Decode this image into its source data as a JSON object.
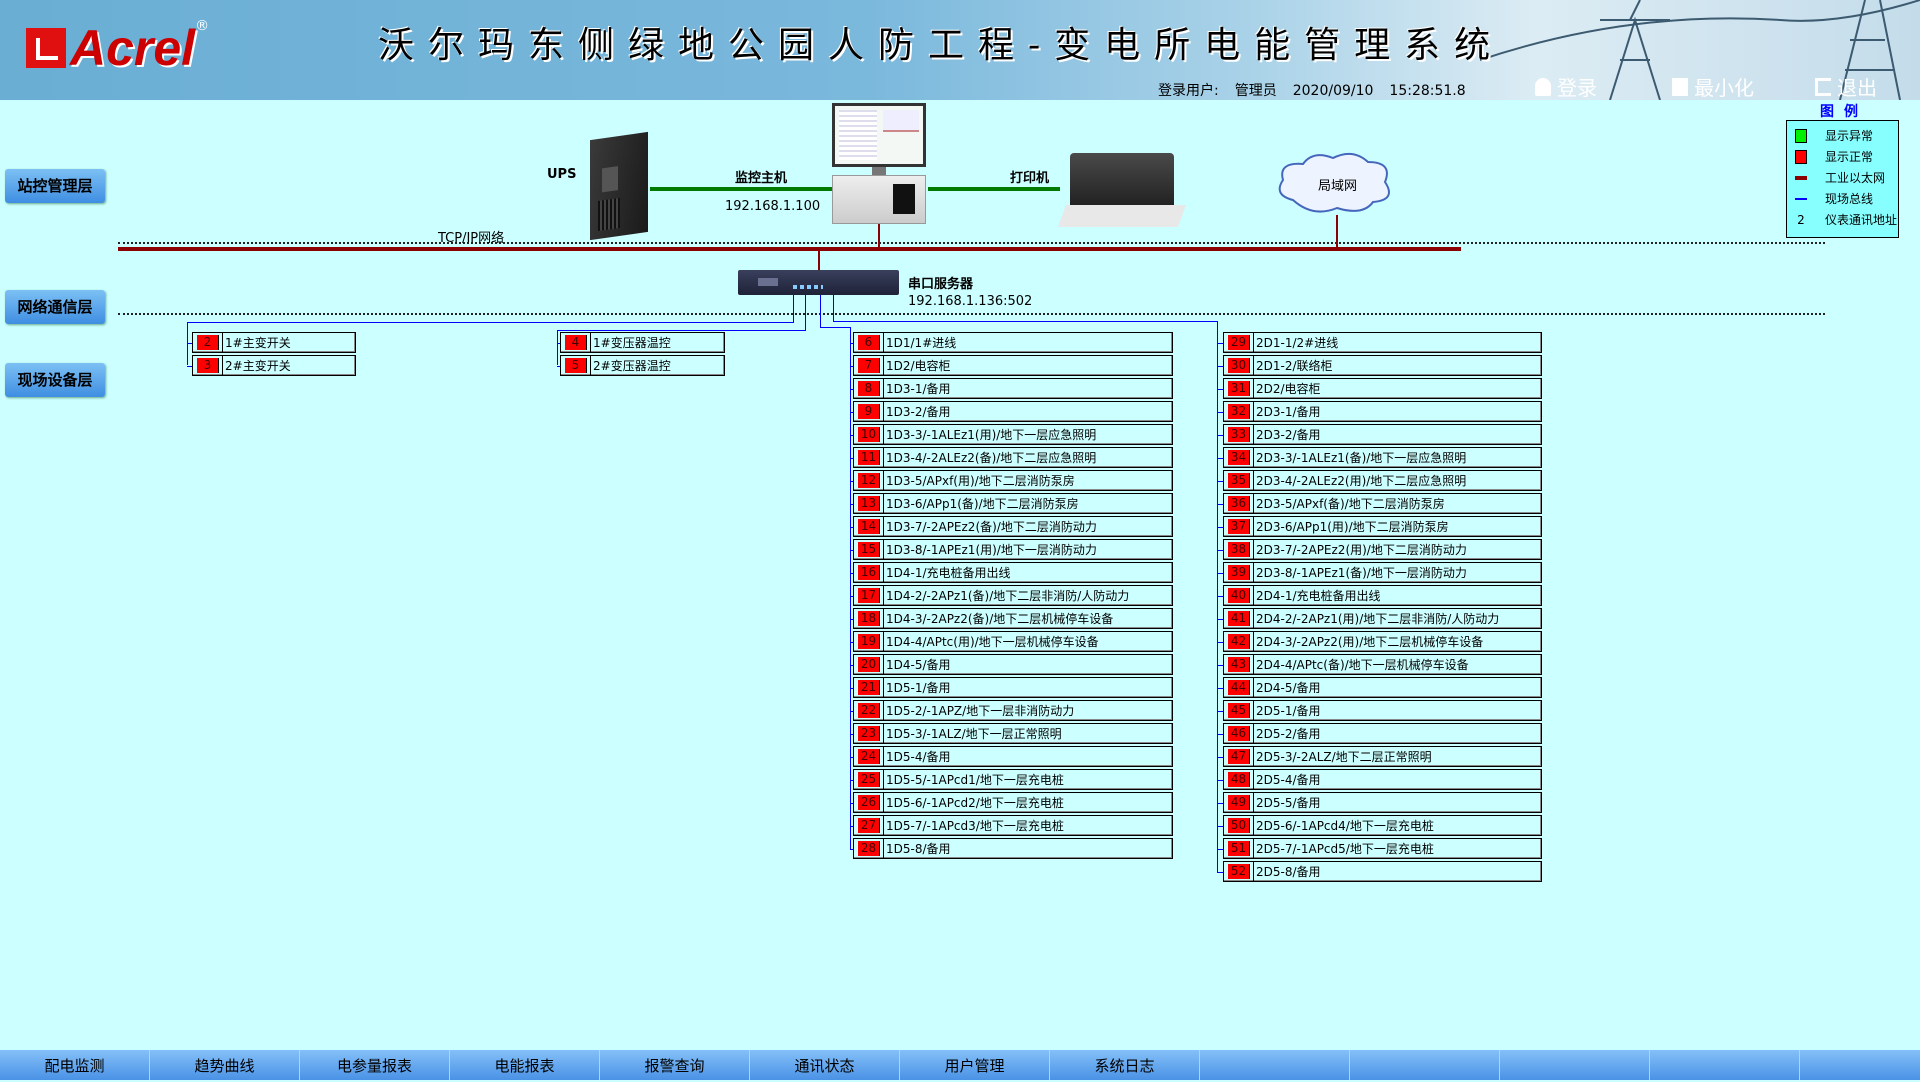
{
  "header": {
    "logo_text": "Acrel",
    "title": "沃尔玛东侧绿地公园人防工程-变电所电能管理系统",
    "login_label": "登录用户:",
    "user": "管理员",
    "date": "2020/09/10",
    "time": "15:28:51.8",
    "buttons": {
      "login": "登录",
      "minimize": "最小化",
      "exit": "退出"
    }
  },
  "layers": [
    "站控管理层",
    "网络通信层",
    "现场设备层"
  ],
  "network": {
    "ups_label": "UPS",
    "host_label": "监控主机",
    "host_ip": "192.168.1.100",
    "printer_label": "打印机",
    "lan_label": "局域网",
    "tcpip_label": "TCP/IP网络",
    "serial_label": "串口服务器",
    "serial_ip": "192.168.1.136:502"
  },
  "legend": {
    "title": "图例",
    "items": [
      {
        "label": "显示异常",
        "color": "#00ee00",
        "type": "square"
      },
      {
        "label": "显示正常",
        "color": "#ff0000",
        "type": "square"
      },
      {
        "label": "工业以太网",
        "color": "#8b0000",
        "type": "thick-line"
      },
      {
        "label": "现场总线",
        "color": "#0000ff",
        "type": "thin-line"
      },
      {
        "label": "仪表通讯地址",
        "symbol": "2",
        "type": "text"
      }
    ]
  },
  "devices": {
    "group1": [
      {
        "id": "2",
        "name": "1#主变开关"
      },
      {
        "id": "3",
        "name": "2#主变开关"
      }
    ],
    "group2": [
      {
        "id": "4",
        "name": "1#变压器温控"
      },
      {
        "id": "5",
        "name": "2#变压器温控"
      }
    ],
    "group3": [
      {
        "id": "6",
        "name": "1D1/1#进线"
      },
      {
        "id": "7",
        "name": "1D2/电容柜"
      },
      {
        "id": "8",
        "name": "1D3-1/备用"
      },
      {
        "id": "9",
        "name": "1D3-2/备用"
      },
      {
        "id": "10",
        "name": "1D3-3/-1ALEz1(用)/地下一层应急照明"
      },
      {
        "id": "11",
        "name": "1D3-4/-2ALEz2(备)/地下二层应急照明"
      },
      {
        "id": "12",
        "name": "1D3-5/APxf(用)/地下二层消防泵房"
      },
      {
        "id": "13",
        "name": "1D3-6/APp1(备)/地下二层消防泵房"
      },
      {
        "id": "14",
        "name": "1D3-7/-2APEz2(备)/地下二层消防动力"
      },
      {
        "id": "15",
        "name": "1D3-8/-1APEz1(用)/地下一层消防动力"
      },
      {
        "id": "16",
        "name": "1D4-1/充电桩备用出线"
      },
      {
        "id": "17",
        "name": "1D4-2/-2APz1(备)/地下二层非消防/人防动力"
      },
      {
        "id": "18",
        "name": "1D4-3/-2APz2(备)/地下二层机械停车设备"
      },
      {
        "id": "19",
        "name": "1D4-4/APtc(用)/地下一层机械停车设备"
      },
      {
        "id": "20",
        "name": "1D4-5/备用"
      },
      {
        "id": "21",
        "name": "1D5-1/备用"
      },
      {
        "id": "22",
        "name": "1D5-2/-1APZ/地下一层非消防动力"
      },
      {
        "id": "23",
        "name": "1D5-3/-1ALZ/地下一层正常照明"
      },
      {
        "id": "24",
        "name": "1D5-4/备用"
      },
      {
        "id": "25",
        "name": "1D5-5/-1APcd1/地下一层充电桩"
      },
      {
        "id": "26",
        "name": "1D5-6/-1APcd2/地下一层充电桩"
      },
      {
        "id": "27",
        "name": "1D5-7/-1APcd3/地下一层充电桩"
      },
      {
        "id": "28",
        "name": "1D5-8/备用"
      }
    ],
    "group4": [
      {
        "id": "29",
        "name": "2D1-1/2#进线"
      },
      {
        "id": "30",
        "name": "2D1-2/联络柜"
      },
      {
        "id": "31",
        "name": "2D2/电容柜"
      },
      {
        "id": "32",
        "name": "2D3-1/备用"
      },
      {
        "id": "33",
        "name": "2D3-2/备用"
      },
      {
        "id": "34",
        "name": "2D3-3/-1ALEz1(备)/地下一层应急照明"
      },
      {
        "id": "35",
        "name": "2D3-4/-2ALEz2(用)/地下二层应急照明"
      },
      {
        "id": "36",
        "name": "2D3-5/APxf(备)/地下二层消防泵房"
      },
      {
        "id": "37",
        "name": "2D3-6/APp1(用)/地下二层消防泵房"
      },
      {
        "id": "38",
        "name": "2D3-7/-2APEz2(用)/地下二层消防动力"
      },
      {
        "id": "39",
        "name": "2D3-8/-1APEz1(备)/地下一层消防动力"
      },
      {
        "id": "40",
        "name": "2D4-1/充电桩备用出线"
      },
      {
        "id": "41",
        "name": "2D4-2/-2APz1(用)/地下二层非消防/人防动力"
      },
      {
        "id": "42",
        "name": "2D4-3/-2APz2(用)/地下二层机械停车设备"
      },
      {
        "id": "43",
        "name": "2D4-4/APtc(备)/地下一层机械停车设备"
      },
      {
        "id": "44",
        "name": "2D4-5/备用"
      },
      {
        "id": "45",
        "name": "2D5-1/备用"
      },
      {
        "id": "46",
        "name": "2D5-2/备用"
      },
      {
        "id": "47",
        "name": "2D5-3/-2ALZ/地下二层正常照明"
      },
      {
        "id": "48",
        "name": "2D5-4/备用"
      },
      {
        "id": "49",
        "name": "2D5-5/备用"
      },
      {
        "id": "50",
        "name": "2D5-6/-1APcd4/地下一层充电桩"
      },
      {
        "id": "51",
        "name": "2D5-7/-1APcd5/地下一层充电桩"
      },
      {
        "id": "52",
        "name": "2D5-8/备用"
      }
    ]
  },
  "status_color": "#ff0000",
  "tabs": [
    "配电监测",
    "趋势曲线",
    "电参量报表",
    "电能报表",
    "报警查询",
    "通讯状态",
    "用户管理",
    "系统日志",
    "",
    "",
    "",
    "",
    ""
  ]
}
